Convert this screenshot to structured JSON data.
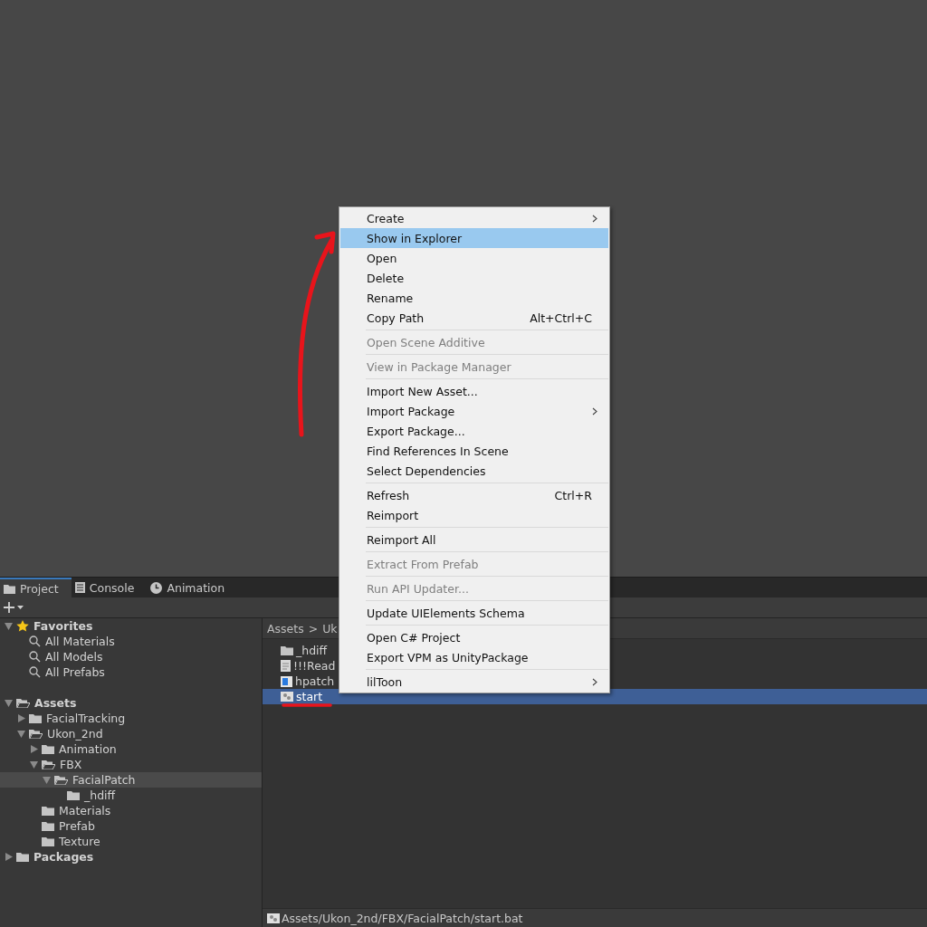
{
  "tabs": [
    {
      "label": "Project",
      "selected": true
    },
    {
      "label": "Console",
      "selected": false
    },
    {
      "label": "Animation",
      "selected": false
    }
  ],
  "tree": {
    "sections": [
      {
        "items": [
          {
            "label": "Favorites",
            "kind": "favorites",
            "expanded": true,
            "selected": false,
            "children": [
              {
                "label": "All Materials",
                "kind": "search",
                "selected": false
              },
              {
                "label": "All Models",
                "kind": "search",
                "selected": false
              },
              {
                "label": "All Prefabs",
                "kind": "search",
                "selected": false
              }
            ]
          }
        ]
      },
      {
        "items": [
          {
            "label": "Assets",
            "kind": "folder",
            "expanded": true,
            "selected": false,
            "children": [
              {
                "label": "FacialTracking",
                "kind": "folder",
                "expanded": false,
                "selected": false
              },
              {
                "label": "Ukon_2nd",
                "kind": "folder",
                "expanded": true,
                "selected": false,
                "children": [
                  {
                    "label": "Animation",
                    "kind": "folder",
                    "expanded": false,
                    "selected": false
                  },
                  {
                    "label": "FBX",
                    "kind": "folder",
                    "expanded": true,
                    "selected": false,
                    "children": [
                      {
                        "label": "FacialPatch",
                        "kind": "folder",
                        "expanded": true,
                        "selected": true,
                        "children": [
                          {
                            "label": "_hdiff",
                            "kind": "folder",
                            "selected": false
                          }
                        ]
                      }
                    ]
                  },
                  {
                    "label": "Materials",
                    "kind": "folder",
                    "selected": false
                  },
                  {
                    "label": "Prefab",
                    "kind": "folder",
                    "selected": false
                  },
                  {
                    "label": "Texture",
                    "kind": "folder",
                    "selected": false
                  }
                ]
              }
            ]
          },
          {
            "label": "Packages",
            "kind": "folder",
            "expanded": false,
            "selected": false
          }
        ]
      }
    ]
  },
  "breadcrumb": [
    "Assets",
    ">",
    "Uk"
  ],
  "files": [
    {
      "label": "_hdiff",
      "kind": "folder",
      "selected": false,
      "underlined": false
    },
    {
      "label": "!!!Read",
      "kind": "text",
      "selected": false,
      "underlined": false
    },
    {
      "label": "hpatch",
      "kind": "image",
      "selected": false,
      "underlined": false
    },
    {
      "label": "start",
      "kind": "script",
      "selected": true,
      "underlined": true
    }
  ],
  "status_bar": {
    "path": "Assets/Ukon_2nd/FBX/FacialPatch/start.bat"
  },
  "context_menu": {
    "sections": [
      {
        "items": [
          {
            "label": "Create",
            "submenu": true,
            "selected": false,
            "disabled": false
          },
          {
            "label": "Show in Explorer",
            "selected": true,
            "disabled": false
          },
          {
            "label": "Open",
            "selected": false,
            "disabled": false
          },
          {
            "label": "Delete",
            "selected": false,
            "disabled": false
          },
          {
            "label": "Rename",
            "selected": false,
            "disabled": false
          },
          {
            "label": "Copy Path",
            "shortcut": "Alt+Ctrl+C",
            "selected": false,
            "disabled": false
          }
        ]
      },
      {
        "items": [
          {
            "label": "Open Scene Additive",
            "selected": false,
            "disabled": true
          }
        ]
      },
      {
        "items": [
          {
            "label": "View in Package Manager",
            "selected": false,
            "disabled": true
          }
        ]
      },
      {
        "items": [
          {
            "label": "Import New Asset...",
            "selected": false,
            "disabled": false
          },
          {
            "label": "Import Package",
            "submenu": true,
            "selected": false,
            "disabled": false
          },
          {
            "label": "Export Package...",
            "selected": false,
            "disabled": false
          },
          {
            "label": "Find References In Scene",
            "selected": false,
            "disabled": false
          },
          {
            "label": "Select Dependencies",
            "selected": false,
            "disabled": false
          }
        ]
      },
      {
        "items": [
          {
            "label": "Refresh",
            "shortcut": "Ctrl+R",
            "selected": false,
            "disabled": false
          },
          {
            "label": "Reimport",
            "selected": false,
            "disabled": false
          }
        ]
      },
      {
        "items": [
          {
            "label": "Reimport All",
            "selected": false,
            "disabled": false
          }
        ]
      },
      {
        "items": [
          {
            "label": "Extract From Prefab",
            "selected": false,
            "disabled": true
          }
        ]
      },
      {
        "items": [
          {
            "label": "Run API Updater...",
            "selected": false,
            "disabled": true
          }
        ]
      },
      {
        "items": [
          {
            "label": "Update UIElements Schema",
            "selected": false,
            "disabled": false
          }
        ]
      },
      {
        "items": [
          {
            "label": "Open C# Project",
            "selected": false,
            "disabled": false
          },
          {
            "label": "Export VPM as UnityPackage",
            "selected": false,
            "disabled": false
          }
        ]
      },
      {
        "items": [
          {
            "label": "lilToon",
            "submenu": true,
            "selected": false,
            "disabled": false
          }
        ]
      }
    ]
  }
}
